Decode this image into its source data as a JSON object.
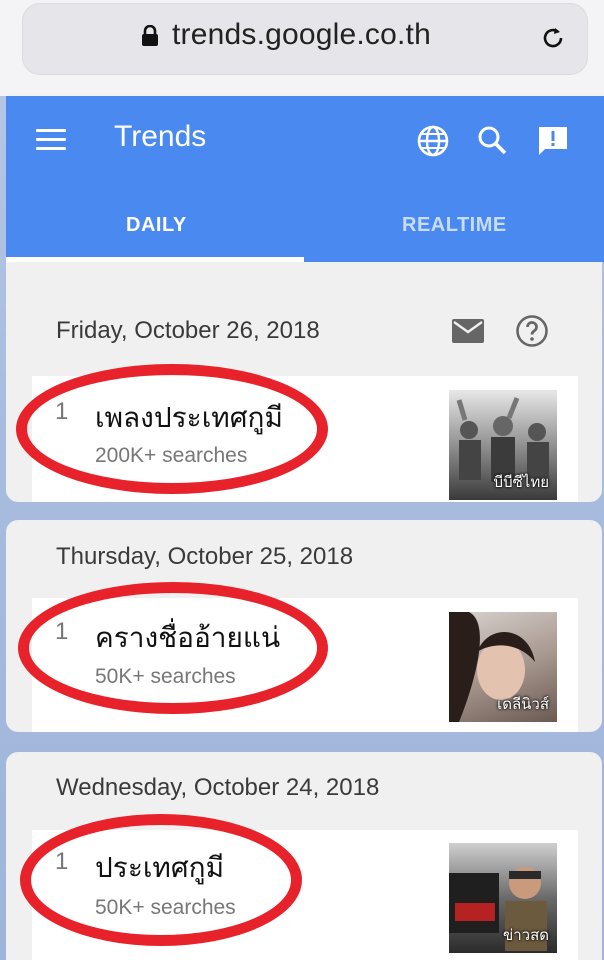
{
  "browser": {
    "url": "trends.google.co.th",
    "lock_icon": "lock-icon",
    "reload_icon": "reload-icon"
  },
  "appbar": {
    "title": "Trends",
    "icons": [
      "menu-icon",
      "globe-icon",
      "search-icon",
      "feedback-icon"
    ],
    "color": "#4a8af0"
  },
  "tabs": [
    {
      "label": "DAILY",
      "selected": true
    },
    {
      "label": "REALTIME",
      "selected": false
    }
  ],
  "days": [
    {
      "date": "Friday, October 26, 2018",
      "items": [
        {
          "rank": "1",
          "term": "เพลงประเทศกูมี",
          "searches": "200K+ searches",
          "thumb_source": "บีบีซีไทย"
        }
      ]
    },
    {
      "date": "Thursday, October 25, 2018",
      "items": [
        {
          "rank": "1",
          "term": "ครางชื่ออ้ายแน่",
          "searches": "50K+ searches",
          "thumb_source": "เดลีนิวส์"
        }
      ]
    },
    {
      "date": "Wednesday, October 24, 2018",
      "items": [
        {
          "rank": "1",
          "term": "ประเทศกูมี",
          "searches": "50K+ searches",
          "thumb_source": "ข่าวสด"
        }
      ]
    }
  ],
  "highlight_color": "#e8222a"
}
